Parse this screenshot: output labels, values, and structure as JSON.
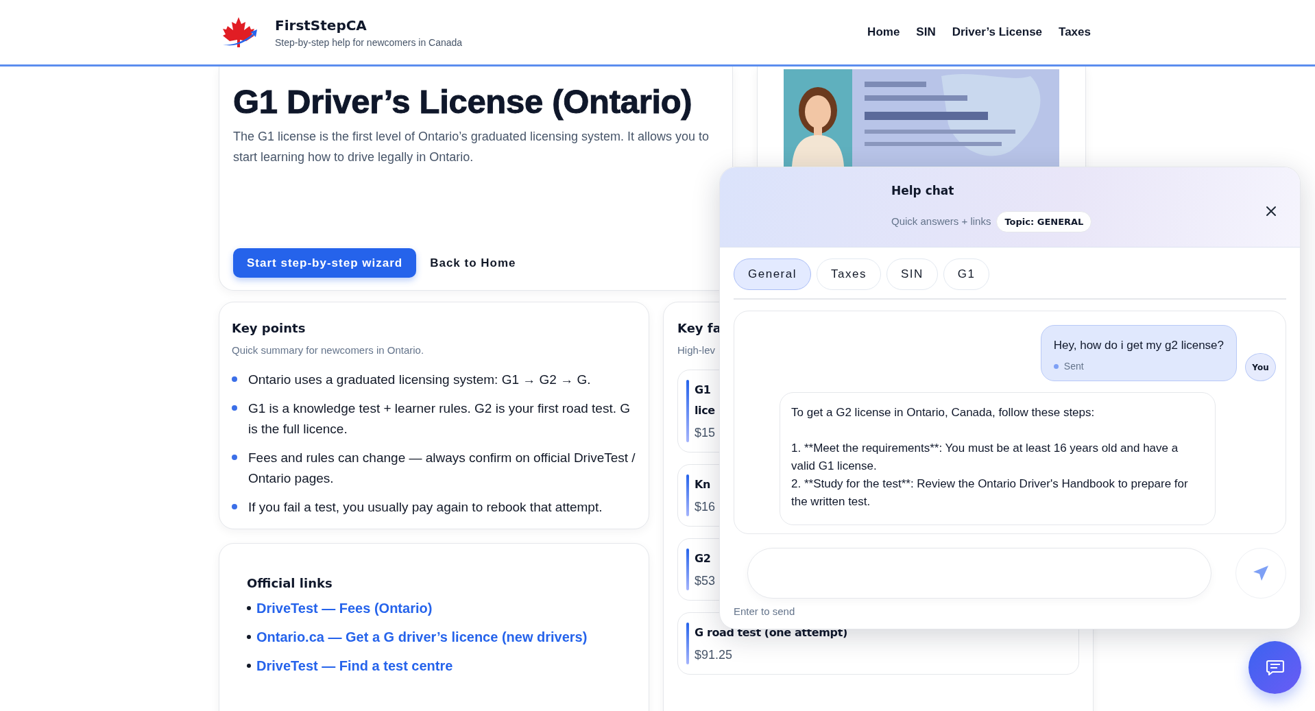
{
  "header": {
    "brand": "FirstStepCA",
    "tagline": "Step-by-step help for newcomers in Canada",
    "nav": [
      {
        "label": "Home"
      },
      {
        "label": "SIN"
      },
      {
        "label": "Driver’s License"
      },
      {
        "label": "Taxes"
      }
    ]
  },
  "hero": {
    "title": "G1 Driver’s License (Ontario)",
    "description": "The G1 license is the first level of Ontario’s graduated licensing system. It allows you to start learning how to drive legally in Ontario.",
    "primary_button": "Start step-by-step wizard",
    "secondary_button": "Back to Home"
  },
  "key_points": {
    "title": "Key points",
    "subtitle": "Quick summary for newcomers in Ontario.",
    "items": [
      "Ontario uses a graduated licensing system: G1 → G2 → G.",
      "G1 is a knowledge test + learner rules. G2 is your first road test. G is the full licence.",
      "Fees and rules can change — always confirm on official DriveTest / Ontario pages.",
      "If you fail a test, you usually pay again to rebook that attempt."
    ]
  },
  "official_links": {
    "title": "Official links",
    "links": [
      "DriveTest — Fees (Ontario)",
      "Ontario.ca — Get a G driver’s licence (new drivers)",
      "DriveTest — Find a test centre"
    ]
  },
  "key_facts": {
    "title": "Key fa",
    "subtitle": "High-lev",
    "facts": [
      {
        "title_lines": [
          "G1",
          "lice"
        ],
        "price": "$15"
      },
      {
        "title_lines": [
          "Kn"
        ],
        "price": "$16"
      },
      {
        "title_lines": [
          "G2"
        ],
        "price": "$53"
      },
      {
        "title_lines": [
          "G road test (one attempt)"
        ],
        "price": "$91.25"
      }
    ]
  },
  "chat": {
    "title": "Help chat",
    "subtitle": "Quick answers + links",
    "topic": "Topic: GENERAL",
    "chips": [
      {
        "label": "General",
        "selected": true
      },
      {
        "label": "Taxes",
        "selected": false
      },
      {
        "label": "SIN",
        "selected": false
      },
      {
        "label": "G1",
        "selected": false
      }
    ],
    "messages": [
      {
        "kind": "user",
        "text": "Hey, how do i get my g2 license?",
        "status": "Sent",
        "avatar": "You"
      },
      {
        "kind": "bot",
        "text": "To get a G2 license in Ontario, Canada, follow these steps:\n\n1. **Meet the requirements**: You must be at least 16 years old and have a valid G1 license.\n2. **Study for the test**: Review the Ontario Driver's Handbook to prepare for the written test."
      }
    ],
    "hint": "Enter to send"
  }
}
